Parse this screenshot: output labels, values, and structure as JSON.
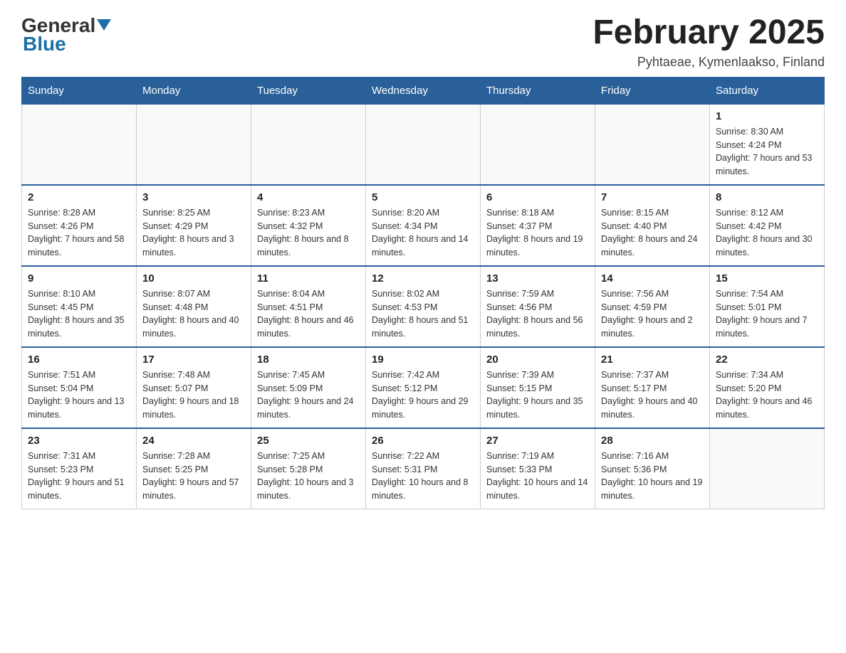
{
  "header": {
    "logo_general": "General",
    "logo_blue": "Blue",
    "month_title": "February 2025",
    "location": "Pyhtaeae, Kymenlaakso, Finland"
  },
  "weekdays": [
    "Sunday",
    "Monday",
    "Tuesday",
    "Wednesday",
    "Thursday",
    "Friday",
    "Saturday"
  ],
  "weeks": [
    [
      {
        "day": "",
        "sunrise": "",
        "sunset": "",
        "daylight": ""
      },
      {
        "day": "",
        "sunrise": "",
        "sunset": "",
        "daylight": ""
      },
      {
        "day": "",
        "sunrise": "",
        "sunset": "",
        "daylight": ""
      },
      {
        "day": "",
        "sunrise": "",
        "sunset": "",
        "daylight": ""
      },
      {
        "day": "",
        "sunrise": "",
        "sunset": "",
        "daylight": ""
      },
      {
        "day": "",
        "sunrise": "",
        "sunset": "",
        "daylight": ""
      },
      {
        "day": "1",
        "sunrise": "Sunrise: 8:30 AM",
        "sunset": "Sunset: 4:24 PM",
        "daylight": "Daylight: 7 hours and 53 minutes."
      }
    ],
    [
      {
        "day": "2",
        "sunrise": "Sunrise: 8:28 AM",
        "sunset": "Sunset: 4:26 PM",
        "daylight": "Daylight: 7 hours and 58 minutes."
      },
      {
        "day": "3",
        "sunrise": "Sunrise: 8:25 AM",
        "sunset": "Sunset: 4:29 PM",
        "daylight": "Daylight: 8 hours and 3 minutes."
      },
      {
        "day": "4",
        "sunrise": "Sunrise: 8:23 AM",
        "sunset": "Sunset: 4:32 PM",
        "daylight": "Daylight: 8 hours and 8 minutes."
      },
      {
        "day": "5",
        "sunrise": "Sunrise: 8:20 AM",
        "sunset": "Sunset: 4:34 PM",
        "daylight": "Daylight: 8 hours and 14 minutes."
      },
      {
        "day": "6",
        "sunrise": "Sunrise: 8:18 AM",
        "sunset": "Sunset: 4:37 PM",
        "daylight": "Daylight: 8 hours and 19 minutes."
      },
      {
        "day": "7",
        "sunrise": "Sunrise: 8:15 AM",
        "sunset": "Sunset: 4:40 PM",
        "daylight": "Daylight: 8 hours and 24 minutes."
      },
      {
        "day": "8",
        "sunrise": "Sunrise: 8:12 AM",
        "sunset": "Sunset: 4:42 PM",
        "daylight": "Daylight: 8 hours and 30 minutes."
      }
    ],
    [
      {
        "day": "9",
        "sunrise": "Sunrise: 8:10 AM",
        "sunset": "Sunset: 4:45 PM",
        "daylight": "Daylight: 8 hours and 35 minutes."
      },
      {
        "day": "10",
        "sunrise": "Sunrise: 8:07 AM",
        "sunset": "Sunset: 4:48 PM",
        "daylight": "Daylight: 8 hours and 40 minutes."
      },
      {
        "day": "11",
        "sunrise": "Sunrise: 8:04 AM",
        "sunset": "Sunset: 4:51 PM",
        "daylight": "Daylight: 8 hours and 46 minutes."
      },
      {
        "day": "12",
        "sunrise": "Sunrise: 8:02 AM",
        "sunset": "Sunset: 4:53 PM",
        "daylight": "Daylight: 8 hours and 51 minutes."
      },
      {
        "day": "13",
        "sunrise": "Sunrise: 7:59 AM",
        "sunset": "Sunset: 4:56 PM",
        "daylight": "Daylight: 8 hours and 56 minutes."
      },
      {
        "day": "14",
        "sunrise": "Sunrise: 7:56 AM",
        "sunset": "Sunset: 4:59 PM",
        "daylight": "Daylight: 9 hours and 2 minutes."
      },
      {
        "day": "15",
        "sunrise": "Sunrise: 7:54 AM",
        "sunset": "Sunset: 5:01 PM",
        "daylight": "Daylight: 9 hours and 7 minutes."
      }
    ],
    [
      {
        "day": "16",
        "sunrise": "Sunrise: 7:51 AM",
        "sunset": "Sunset: 5:04 PM",
        "daylight": "Daylight: 9 hours and 13 minutes."
      },
      {
        "day": "17",
        "sunrise": "Sunrise: 7:48 AM",
        "sunset": "Sunset: 5:07 PM",
        "daylight": "Daylight: 9 hours and 18 minutes."
      },
      {
        "day": "18",
        "sunrise": "Sunrise: 7:45 AM",
        "sunset": "Sunset: 5:09 PM",
        "daylight": "Daylight: 9 hours and 24 minutes."
      },
      {
        "day": "19",
        "sunrise": "Sunrise: 7:42 AM",
        "sunset": "Sunset: 5:12 PM",
        "daylight": "Daylight: 9 hours and 29 minutes."
      },
      {
        "day": "20",
        "sunrise": "Sunrise: 7:39 AM",
        "sunset": "Sunset: 5:15 PM",
        "daylight": "Daylight: 9 hours and 35 minutes."
      },
      {
        "day": "21",
        "sunrise": "Sunrise: 7:37 AM",
        "sunset": "Sunset: 5:17 PM",
        "daylight": "Daylight: 9 hours and 40 minutes."
      },
      {
        "day": "22",
        "sunrise": "Sunrise: 7:34 AM",
        "sunset": "Sunset: 5:20 PM",
        "daylight": "Daylight: 9 hours and 46 minutes."
      }
    ],
    [
      {
        "day": "23",
        "sunrise": "Sunrise: 7:31 AM",
        "sunset": "Sunset: 5:23 PM",
        "daylight": "Daylight: 9 hours and 51 minutes."
      },
      {
        "day": "24",
        "sunrise": "Sunrise: 7:28 AM",
        "sunset": "Sunset: 5:25 PM",
        "daylight": "Daylight: 9 hours and 57 minutes."
      },
      {
        "day": "25",
        "sunrise": "Sunrise: 7:25 AM",
        "sunset": "Sunset: 5:28 PM",
        "daylight": "Daylight: 10 hours and 3 minutes."
      },
      {
        "day": "26",
        "sunrise": "Sunrise: 7:22 AM",
        "sunset": "Sunset: 5:31 PM",
        "daylight": "Daylight: 10 hours and 8 minutes."
      },
      {
        "day": "27",
        "sunrise": "Sunrise: 7:19 AM",
        "sunset": "Sunset: 5:33 PM",
        "daylight": "Daylight: 10 hours and 14 minutes."
      },
      {
        "day": "28",
        "sunrise": "Sunrise: 7:16 AM",
        "sunset": "Sunset: 5:36 PM",
        "daylight": "Daylight: 10 hours and 19 minutes."
      },
      {
        "day": "",
        "sunrise": "",
        "sunset": "",
        "daylight": ""
      }
    ]
  ]
}
